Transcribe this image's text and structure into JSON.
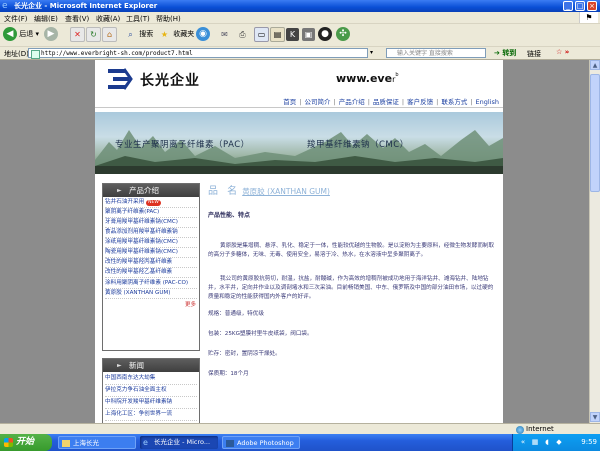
{
  "window": {
    "title": "长光企业 - Microsoft Internet Explorer",
    "controls": {
      "minimize": "_",
      "maximize": "□",
      "close": "×"
    }
  },
  "menu": [
    "文件(F)",
    "编辑(E)",
    "查看(V)",
    "收藏(A)",
    "工具(T)",
    "帮助(H)"
  ],
  "toolbar": {
    "back": "后退",
    "search": "搜索",
    "favorites": "收藏夹"
  },
  "address": {
    "label": "地址(D)",
    "url": "http://www.everbright-sh.com/product7.html",
    "search_placeholder": "输入关键字 直接搜索",
    "go": "转到",
    "links": "链接"
  },
  "site": {
    "brand": "长光企业",
    "domain_bold": "www.eve",
    "domain_tail": "r",
    "domain_tiny": "b",
    "nav": [
      "首页",
      "公司简介",
      "产品介绍",
      "品质保证",
      "客户反馈",
      "联系方式",
      "English"
    ],
    "banner_left": "专业生产聚阴离子纤维素（PAC）",
    "banner_right": "羧甲基纤维素钠（CMC）"
  },
  "sidebar": {
    "products_title": "产品介绍",
    "products": [
      "钻井石油开采用",
      "聚阴离子纤维素(PAC)",
      "牙膏用羧甲基纤维素钠(CMC)",
      "食品添加剂用羧甲基纤维素钠",
      "涂纸用羧甲基纤维素钠(CMC)",
      "陶瓷用羧甲基纤维素钠(CMC)",
      "改性的羧甲基羟丙基纤维素",
      "改性的羧甲基羟乙基纤维素",
      "涂料用聚阴离子纤维素 (PAC-CO)",
      "黄原胶 (XANTHAN GUM)"
    ],
    "new_badge": "NEW",
    "more": "更多",
    "news_title": "新闻",
    "news": [
      "中国西南东达大劫集",
      "伊拉克力争石油全面主权",
      "中科院开发羧甲基纤维素钠",
      "上海化工区：争创世界一流"
    ]
  },
  "product": {
    "title": "品 名",
    "subtitle": "黄原胶 (XANTHAN GUM)",
    "perf_label": "产品性能、特点",
    "paragraphs": [
      "黄原胶是集增稠、悬浮、乳化、稳定于一体，性能较优越的生物胶。是以淀粉为主要原料，经微生物发酵而制取的高分子多糖体，无味、无毒、使用安全，易溶于冷、热水，在水溶液中呈多聚阴离子。",
      "我公司的黄原胶抗剪切，耐温，抗盐，耐酸碱，作为高效的增稠剂被成功地用于海洋钻井、滩海钻井、陆地钻井，水平井，定向井作业以及调剖堵水和三次采油。目前畅销美国、中东、俄罗斯及中国的部分油田市场，以过硬的质量和稳定的性能获得国内外客户的好评。",
      "规格：普通级，特优级",
      "包装：25KG塑膜衬里牛皮纸袋，阀口袋。",
      "贮存：密封，置阴凉干燥处。",
      "保质期：18个月"
    ]
  },
  "status": {
    "zone": "Internet"
  },
  "taskbar": {
    "start": "开始",
    "tasks": [
      "上海长光",
      "长光企业 - Micro...",
      "Adobe Photoshop"
    ],
    "clock": "9:59"
  },
  "colors": {
    "title_blue": "#0a4fd6",
    "link_blue": "#1a3a9c",
    "product_title": "#8fb3d8",
    "body_text": "#3a3a78"
  }
}
